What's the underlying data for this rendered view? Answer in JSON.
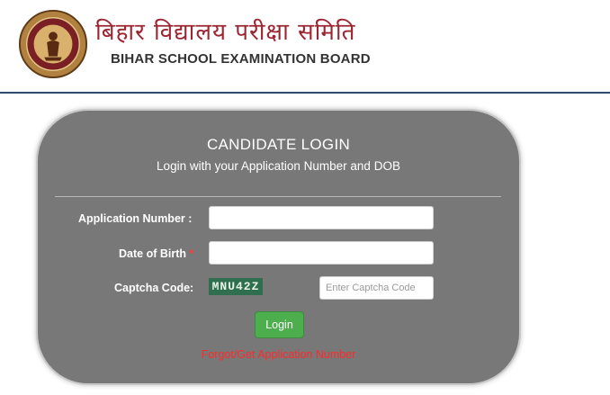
{
  "header": {
    "title_hindi": "बिहार विद्यालय परीक्षा समिति",
    "title_english": "BIHAR SCHOOL EXAMINATION BOARD",
    "logo_icon": "bseb-emblem-icon"
  },
  "login": {
    "title": "CANDIDATE LOGIN",
    "subtitle": "Login with your Application Number and DOB",
    "application_number_label": "Application Number :",
    "application_number_value": "",
    "dob_label": "Date of Birth",
    "dob_required_marker": "*",
    "dob_value": "",
    "captcha_label": "Captcha Code:",
    "captcha_code": "MNU42Z",
    "captcha_placeholder": "Enter Captcha Code",
    "captcha_value": "",
    "login_button": "Login",
    "forgot_link": "Forgot/Get Application Number"
  },
  "colors": {
    "brand_maroon": "#9c2532",
    "panel_gray": "#787878",
    "button_green": "#4cae4c",
    "captcha_green": "#2f6f4f",
    "link_red": "#ff2a2a"
  }
}
